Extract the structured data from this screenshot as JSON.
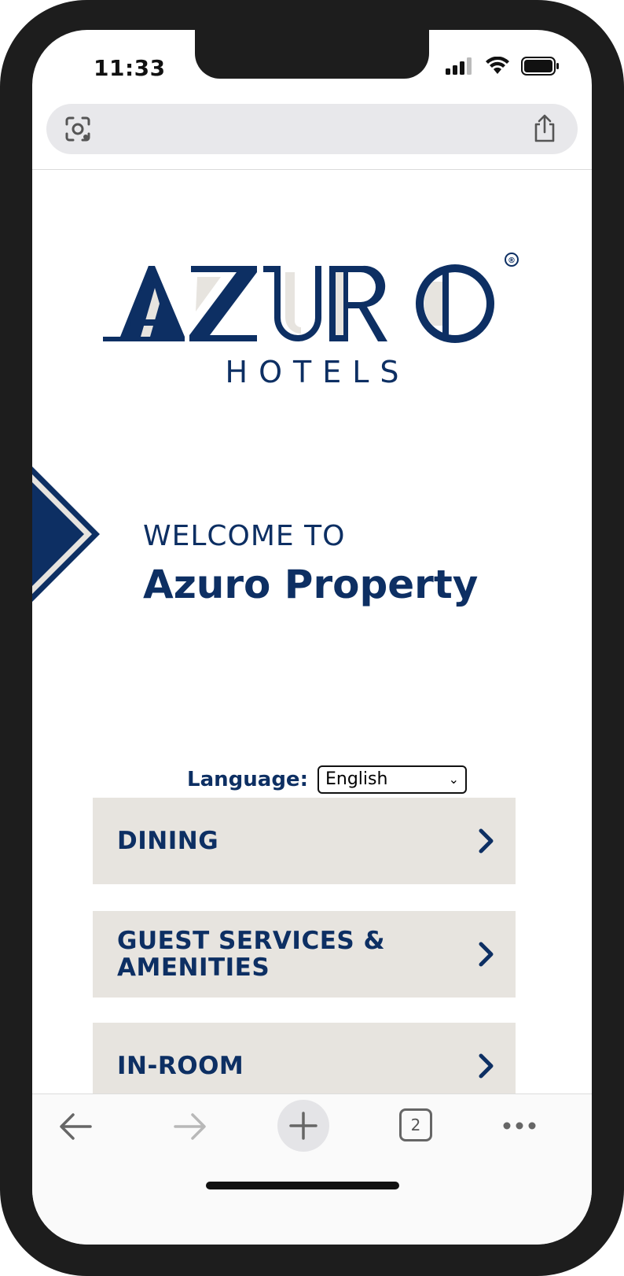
{
  "status_bar": {
    "time": "11:33"
  },
  "browser": {
    "tab_count": "2"
  },
  "brand": {
    "name": "AZURO",
    "registered_mark": "®",
    "subtitle": "HOTELS"
  },
  "welcome": {
    "line1": "WELCOME TO",
    "line2": "Azuro Property"
  },
  "language": {
    "label": "Language:",
    "selected": "English"
  },
  "menu": [
    {
      "label": "DINING"
    },
    {
      "label": "GUEST SERVICES & AMENITIES"
    },
    {
      "label": "IN-ROOM"
    }
  ],
  "colors": {
    "brand_navy": "#0d2f63",
    "card_beige": "#e7e4df"
  }
}
